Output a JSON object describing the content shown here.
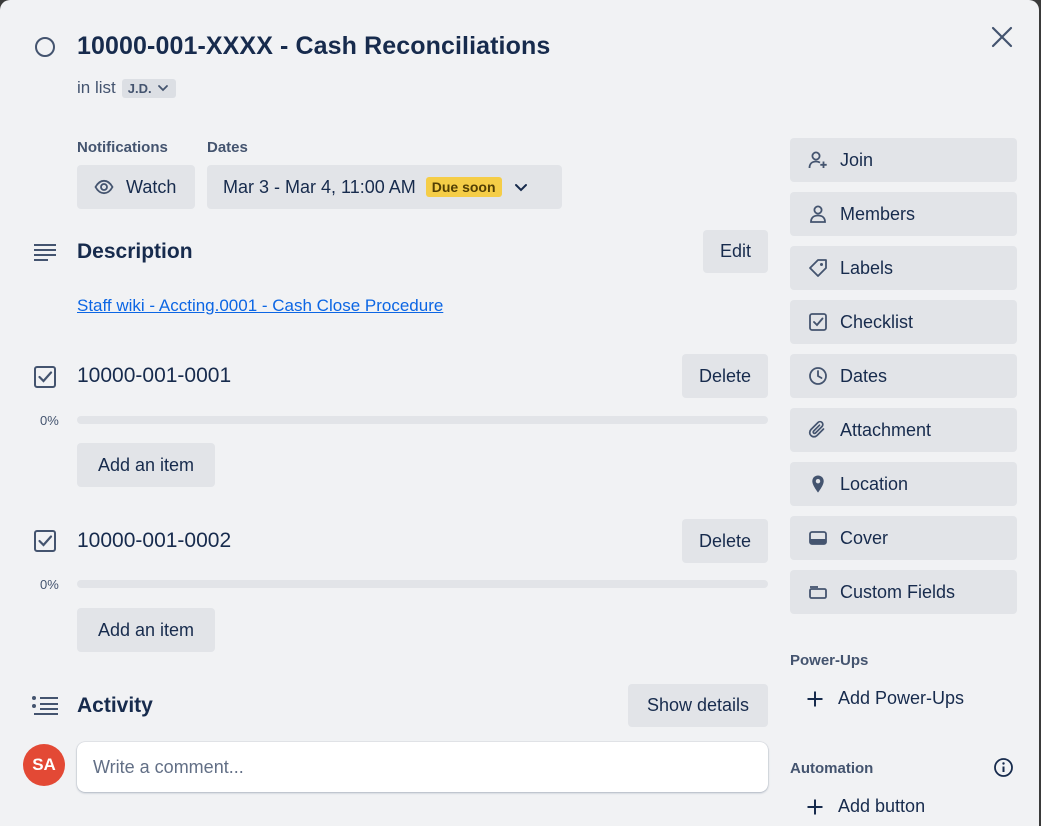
{
  "card": {
    "title": "10000-001-XXXX - Cash Reconciliations",
    "in_list_prefix": "in list",
    "list_name": "J.D."
  },
  "notifications": {
    "label": "Notifications",
    "watch_label": "Watch"
  },
  "dates": {
    "label": "Dates",
    "range": "Mar 3 - Mar 4, 11:00 AM",
    "badge": "Due soon",
    "badge_color": "#f5cd47"
  },
  "description": {
    "title": "Description",
    "edit_label": "Edit",
    "link_text": "Staff wiki - Accting.0001 - Cash Close Procedure"
  },
  "checklists": [
    {
      "title": "10000-001-0001",
      "delete_label": "Delete",
      "percent_label": "0%",
      "progress": 0,
      "add_item_label": "Add an item"
    },
    {
      "title": "10000-001-0002",
      "delete_label": "Delete",
      "percent_label": "0%",
      "progress": 0,
      "add_item_label": "Add an item"
    }
  ],
  "activity": {
    "title": "Activity",
    "show_details_label": "Show details",
    "comment_placeholder": "Write a comment...",
    "avatar_initials": "SA",
    "avatar_color": "#e34935"
  },
  "sidebar": {
    "buttons": [
      {
        "label": "Join",
        "icon": "add-person-icon"
      },
      {
        "label": "Members",
        "icon": "person-icon"
      },
      {
        "label": "Labels",
        "icon": "tag-icon"
      },
      {
        "label": "Checklist",
        "icon": "checkbox-icon"
      },
      {
        "label": "Dates",
        "icon": "clock-icon"
      },
      {
        "label": "Attachment",
        "icon": "paperclip-icon"
      },
      {
        "label": "Location",
        "icon": "location-pin-icon"
      },
      {
        "label": "Cover",
        "icon": "cover-icon"
      },
      {
        "label": "Custom Fields",
        "icon": "custom-fields-icon"
      }
    ],
    "power_ups": {
      "heading": "Power-Ups",
      "add_label": "Add Power-Ups"
    },
    "automation": {
      "heading": "Automation",
      "add_label": "Add button"
    }
  }
}
